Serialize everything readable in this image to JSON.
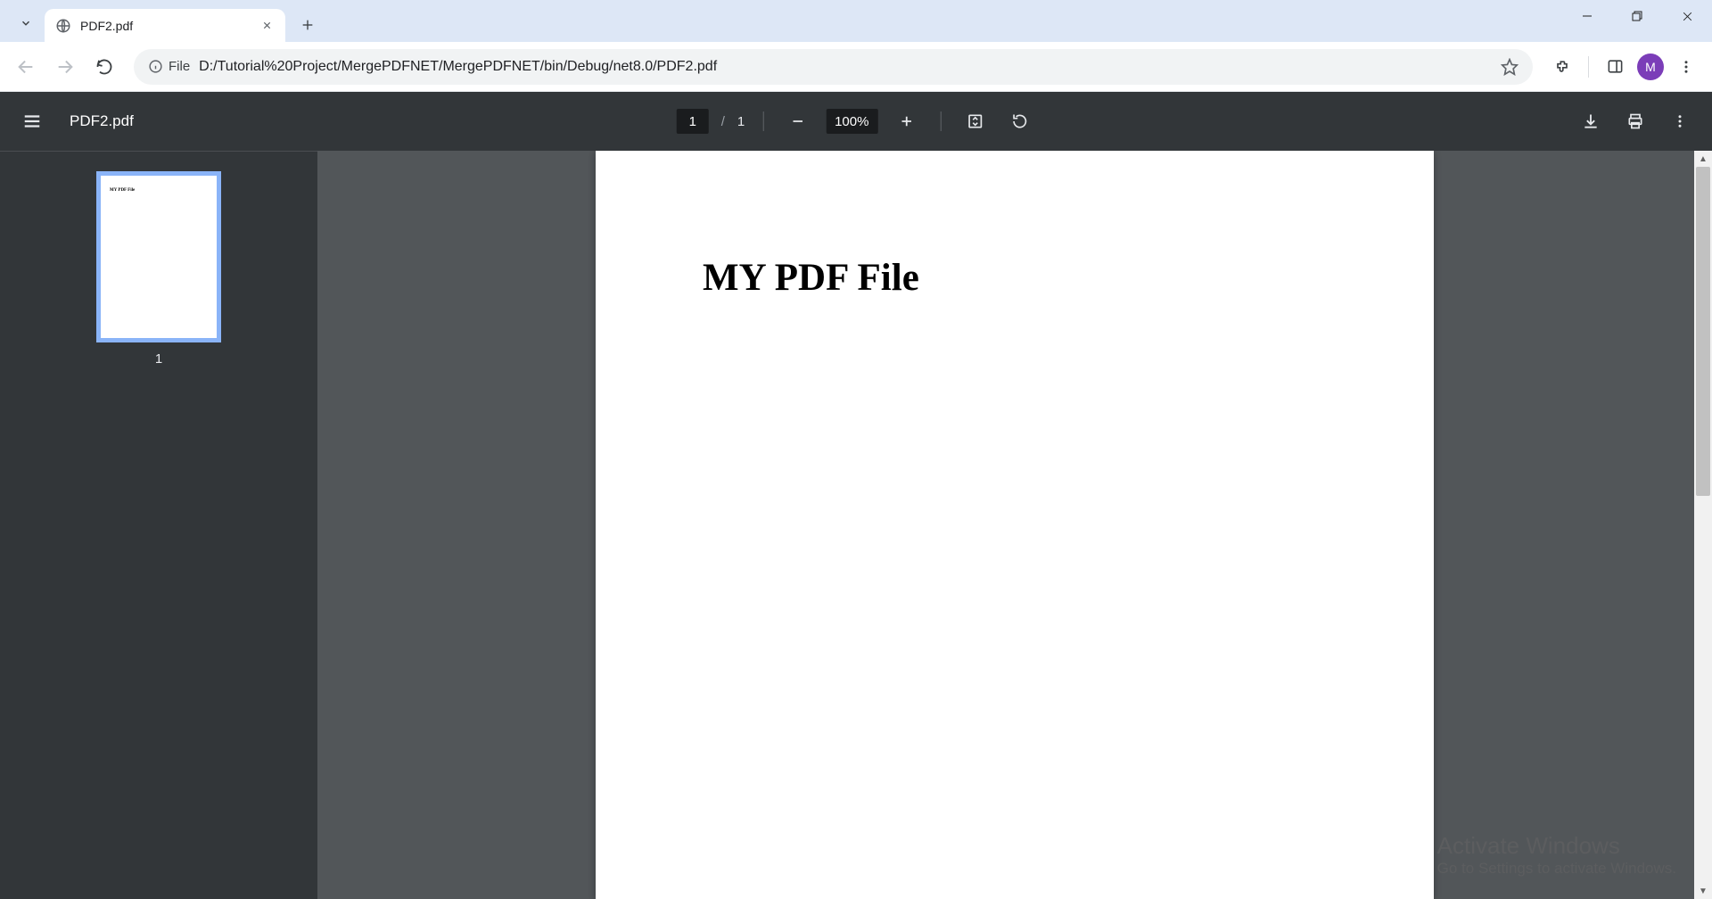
{
  "browser": {
    "tab_title": "PDF2.pdf",
    "url": "D:/Tutorial%20Project/MergePDFNET/MergePDFNET/bin/Debug/net8.0/PDF2.pdf",
    "file_chip": "File",
    "avatar_letter": "M"
  },
  "pdf": {
    "filename": "PDF2.pdf",
    "current_page": "1",
    "total_pages": "1",
    "zoom": "100%",
    "document_heading": "MY PDF File",
    "thumb_heading": "MY PDF File",
    "thumb_label": "1"
  },
  "overlay": {
    "line1": "Activate Windows",
    "line2": "Go to Settings to activate Windows."
  }
}
